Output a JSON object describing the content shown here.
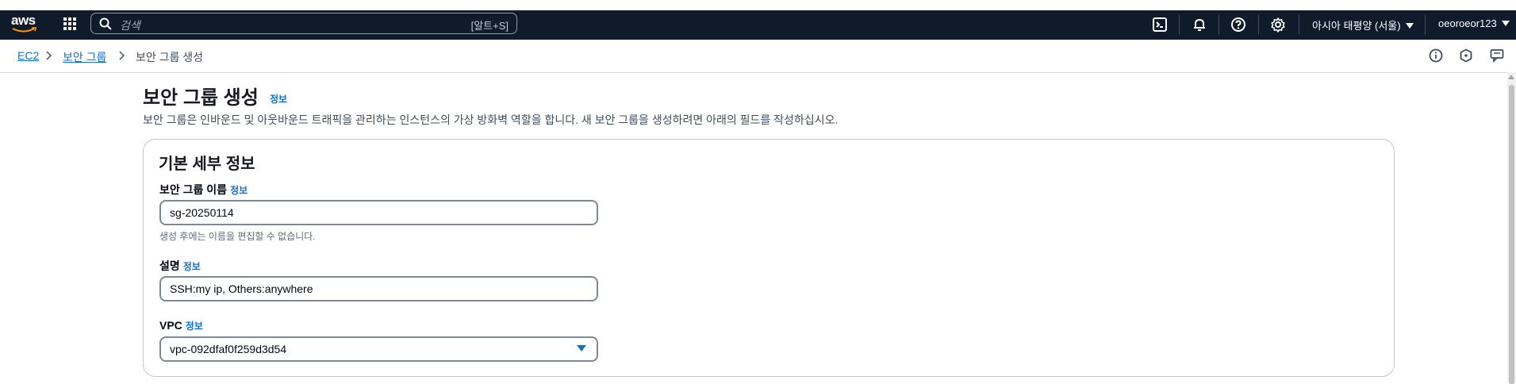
{
  "topbar": {
    "logo_text": "aws",
    "search_placeholder": "검색",
    "search_shortcut": "[알트+S]",
    "icons": [
      "cloudshell-icon",
      "bell-icon",
      "help-icon",
      "gear-icon"
    ],
    "region": "아시아 태평양 (서울)",
    "user": "oeoroeor123",
    "bg_color": "#0f1b2a"
  },
  "breadcrumb": {
    "items": [
      "EC2",
      "보안 그룹",
      "보안 그룹 생성"
    ]
  },
  "page": {
    "title": "보안 그룹 생성",
    "title_info": "정보",
    "description": "보안 그룹은 인바운드 및 아웃바운드 트래픽을 관리하는 인스턴스의 가상 방화벽 역할을 합니다. 새 보안 그룹을 생성하려면 아래의 필드를 작성하십시오."
  },
  "details": {
    "title": "기본 세부 정보",
    "name_label": "보안 그룹 이름",
    "name_info": "정보",
    "name_value": "sg-20250114",
    "name_hint": "생성 후에는 이름을 편집할 수 없습니다.",
    "desc_label": "설명",
    "desc_info": "정보",
    "desc_value": "SSH:my ip, Others:anywhere",
    "vpc_label": "VPC",
    "vpc_info": "정보",
    "vpc_value": "vpc-092dfaf0f259d3d54"
  },
  "colors": {
    "link": "#0972d3",
    "text": "#16191f"
  }
}
